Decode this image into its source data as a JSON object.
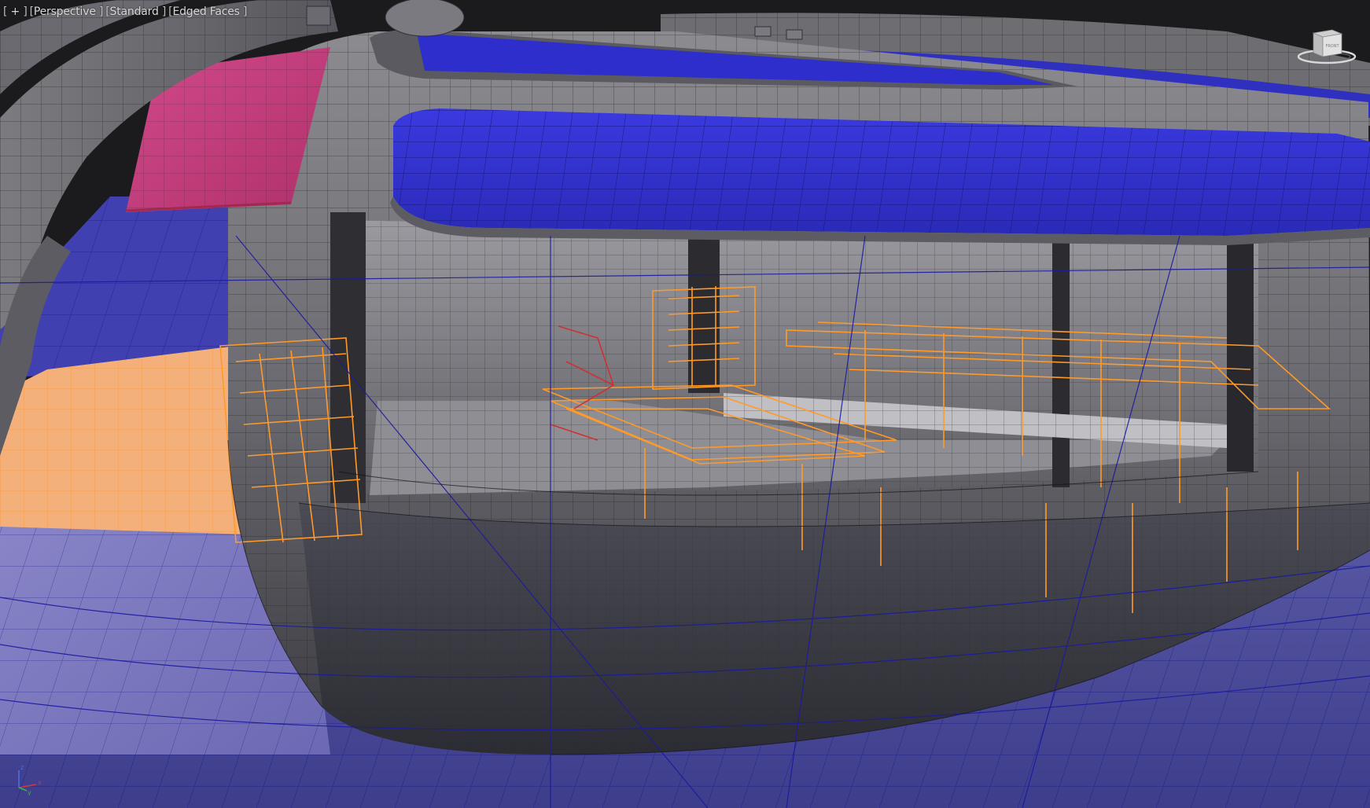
{
  "viewport": {
    "labels": [
      {
        "id": "plus",
        "text": "+"
      },
      {
        "id": "view",
        "text": "Perspective"
      },
      {
        "id": "shading",
        "text": "Standard"
      },
      {
        "id": "display",
        "text": "Edged Faces"
      }
    ]
  },
  "viewcube": {
    "face_label": "FRONT",
    "icon": "viewcube-icon"
  },
  "axis_tripod": {
    "axes": [
      "x",
      "y",
      "z"
    ],
    "icon": "axis-tripod-icon"
  },
  "colors": {
    "background": "#1b1b1d",
    "hull_gray": "#6b6b70",
    "selected_blue": "#3333c8",
    "magenta": "#c83a78",
    "orange_wire": "#ff9a33",
    "peach_deck": "#f6b27a",
    "wire_dark": "#1a1a1a"
  }
}
